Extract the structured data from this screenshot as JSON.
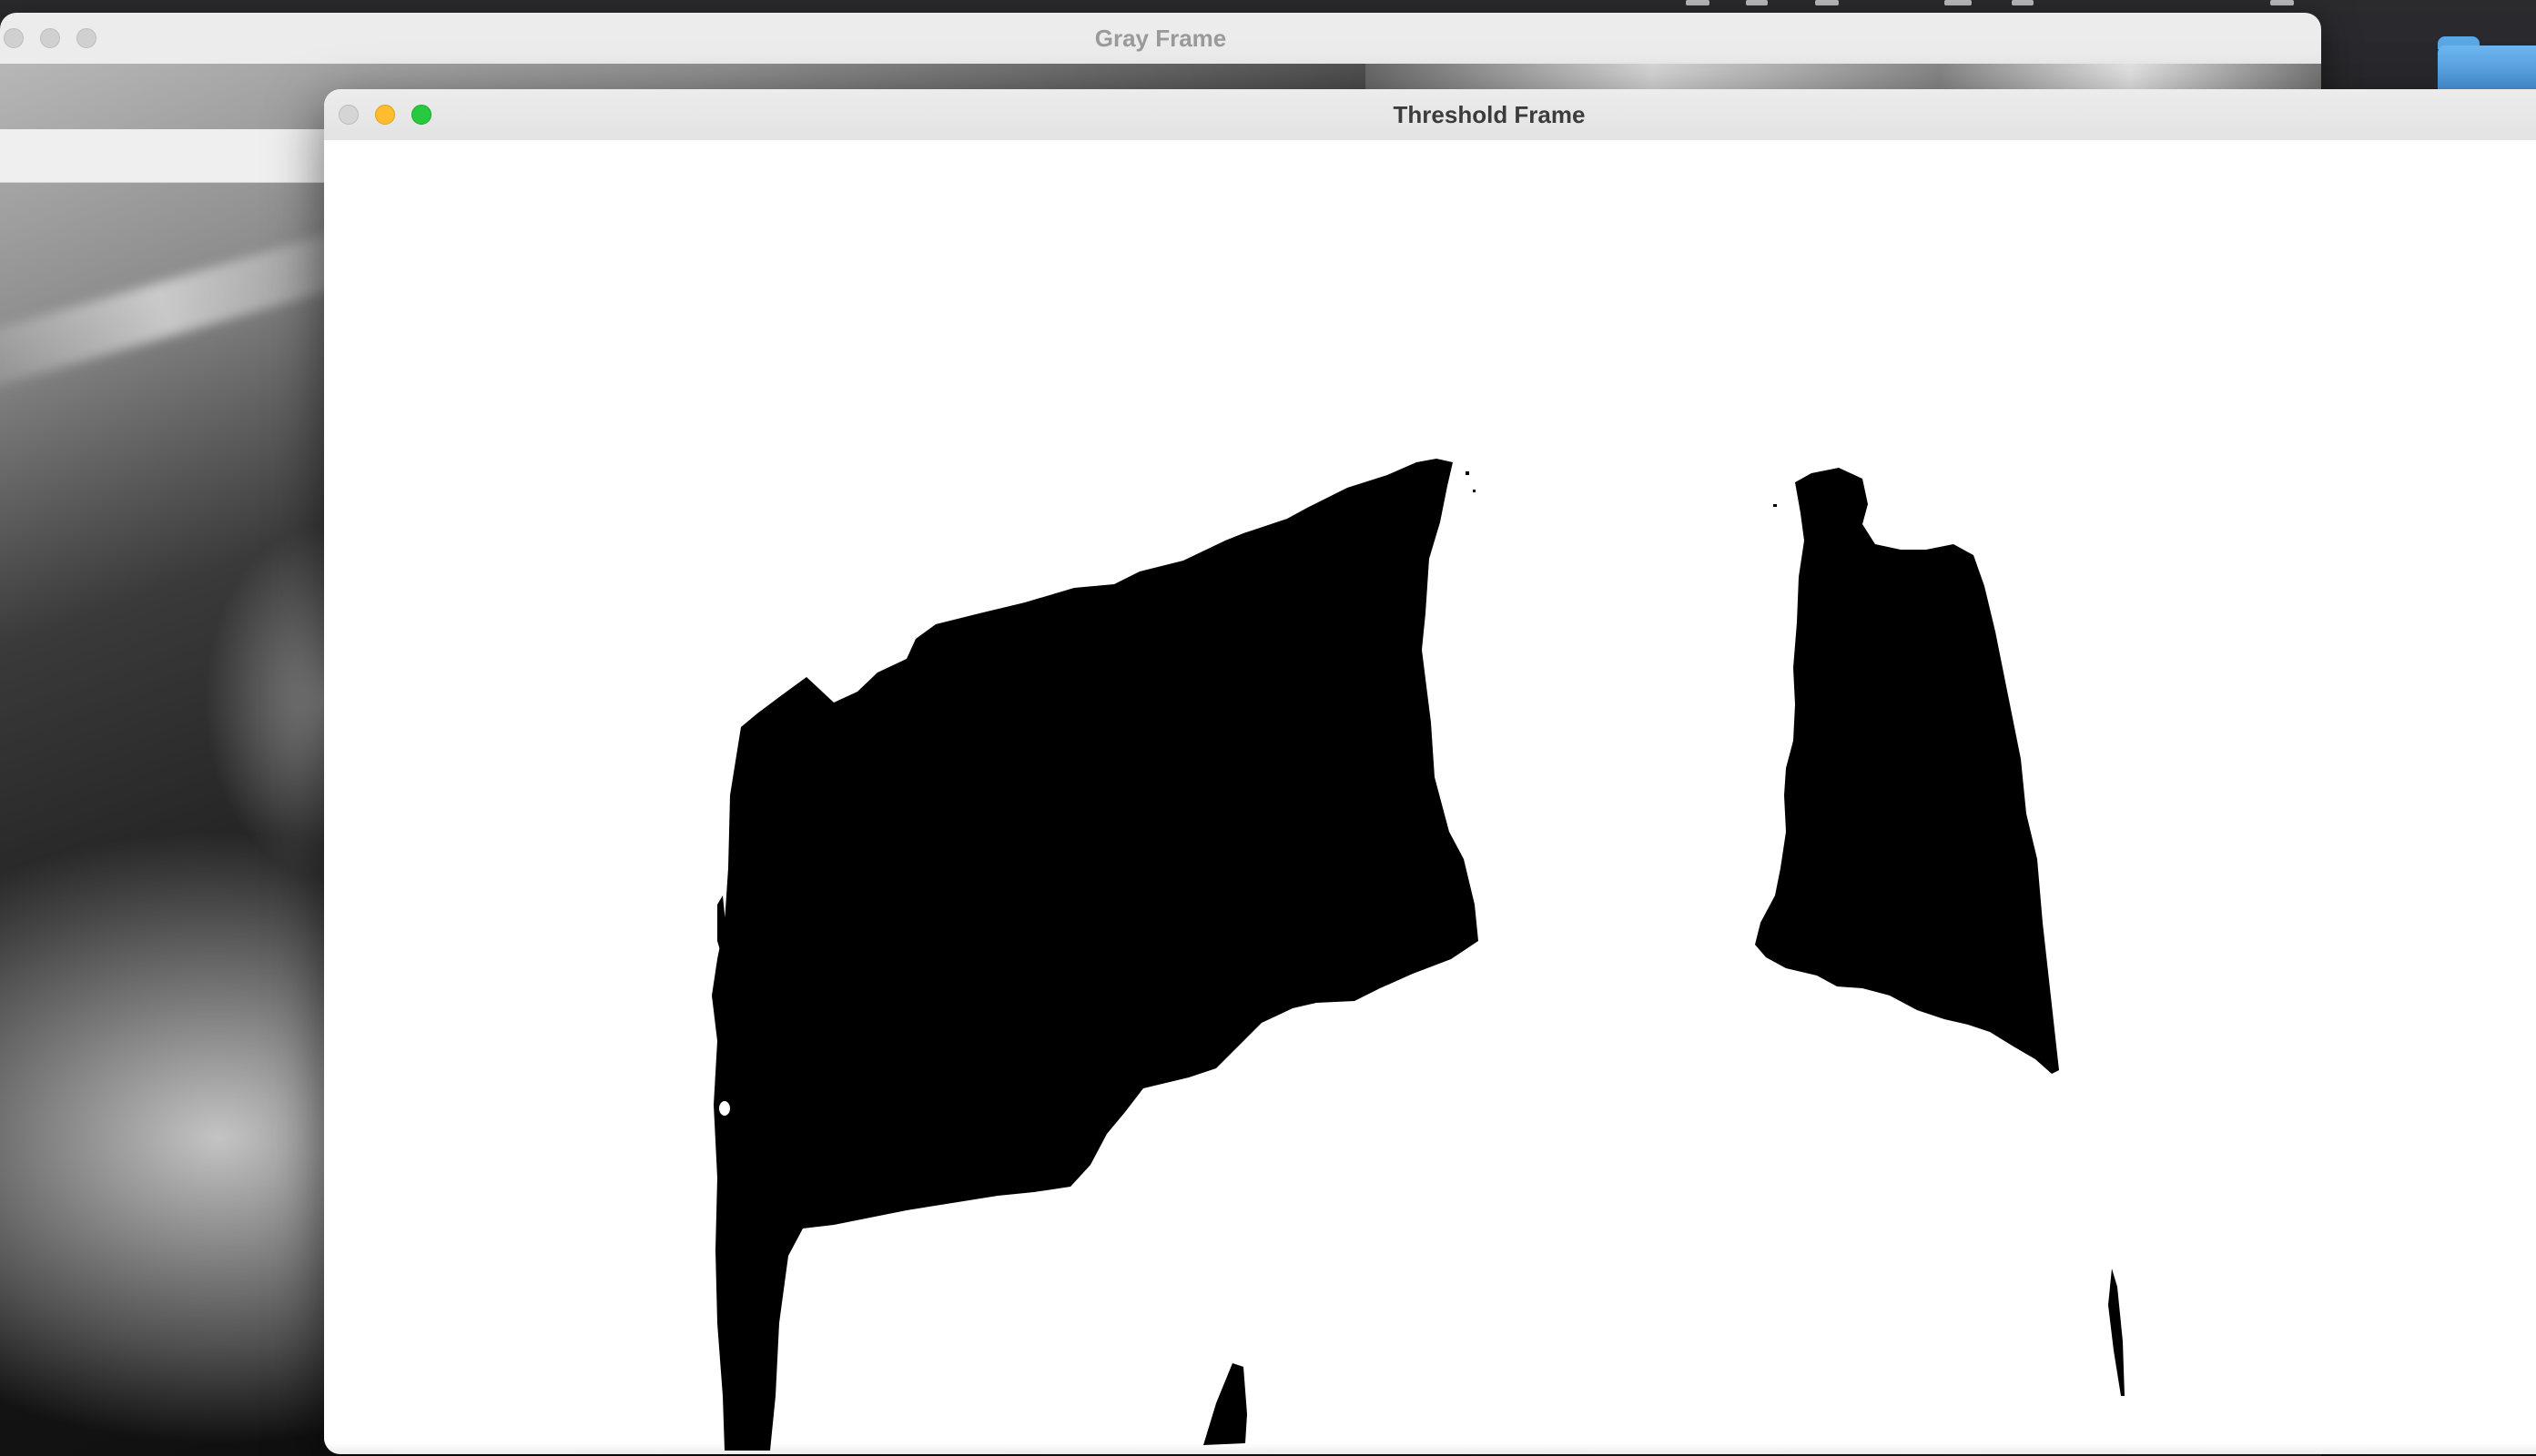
{
  "desktop": {
    "menubar_icons": [
      "menu-extra-icon",
      "menu-extra-icon",
      "menu-extra-icon",
      "menu-extra-icon",
      "menu-extra-icon",
      "menu-extra-icon"
    ],
    "folder_icon": "folder-icon",
    "colors": {
      "folder": "#5aa7e6",
      "menubar": "#2b2b2e"
    }
  },
  "gray_window": {
    "title": "Gray Frame",
    "controls": [
      "close-button",
      "minimize-button",
      "zoom-button"
    ],
    "state": "inactive"
  },
  "threshold_window": {
    "title": "Threshold Frame",
    "controls": [
      "close-button",
      "minimize-button",
      "zoom-button"
    ],
    "state": "active",
    "colors": {
      "close": "#d5d5d5",
      "minimize": "#febc2e",
      "zoom": "#28c840",
      "foreground": "#000000",
      "background": "#ffffff"
    }
  }
}
